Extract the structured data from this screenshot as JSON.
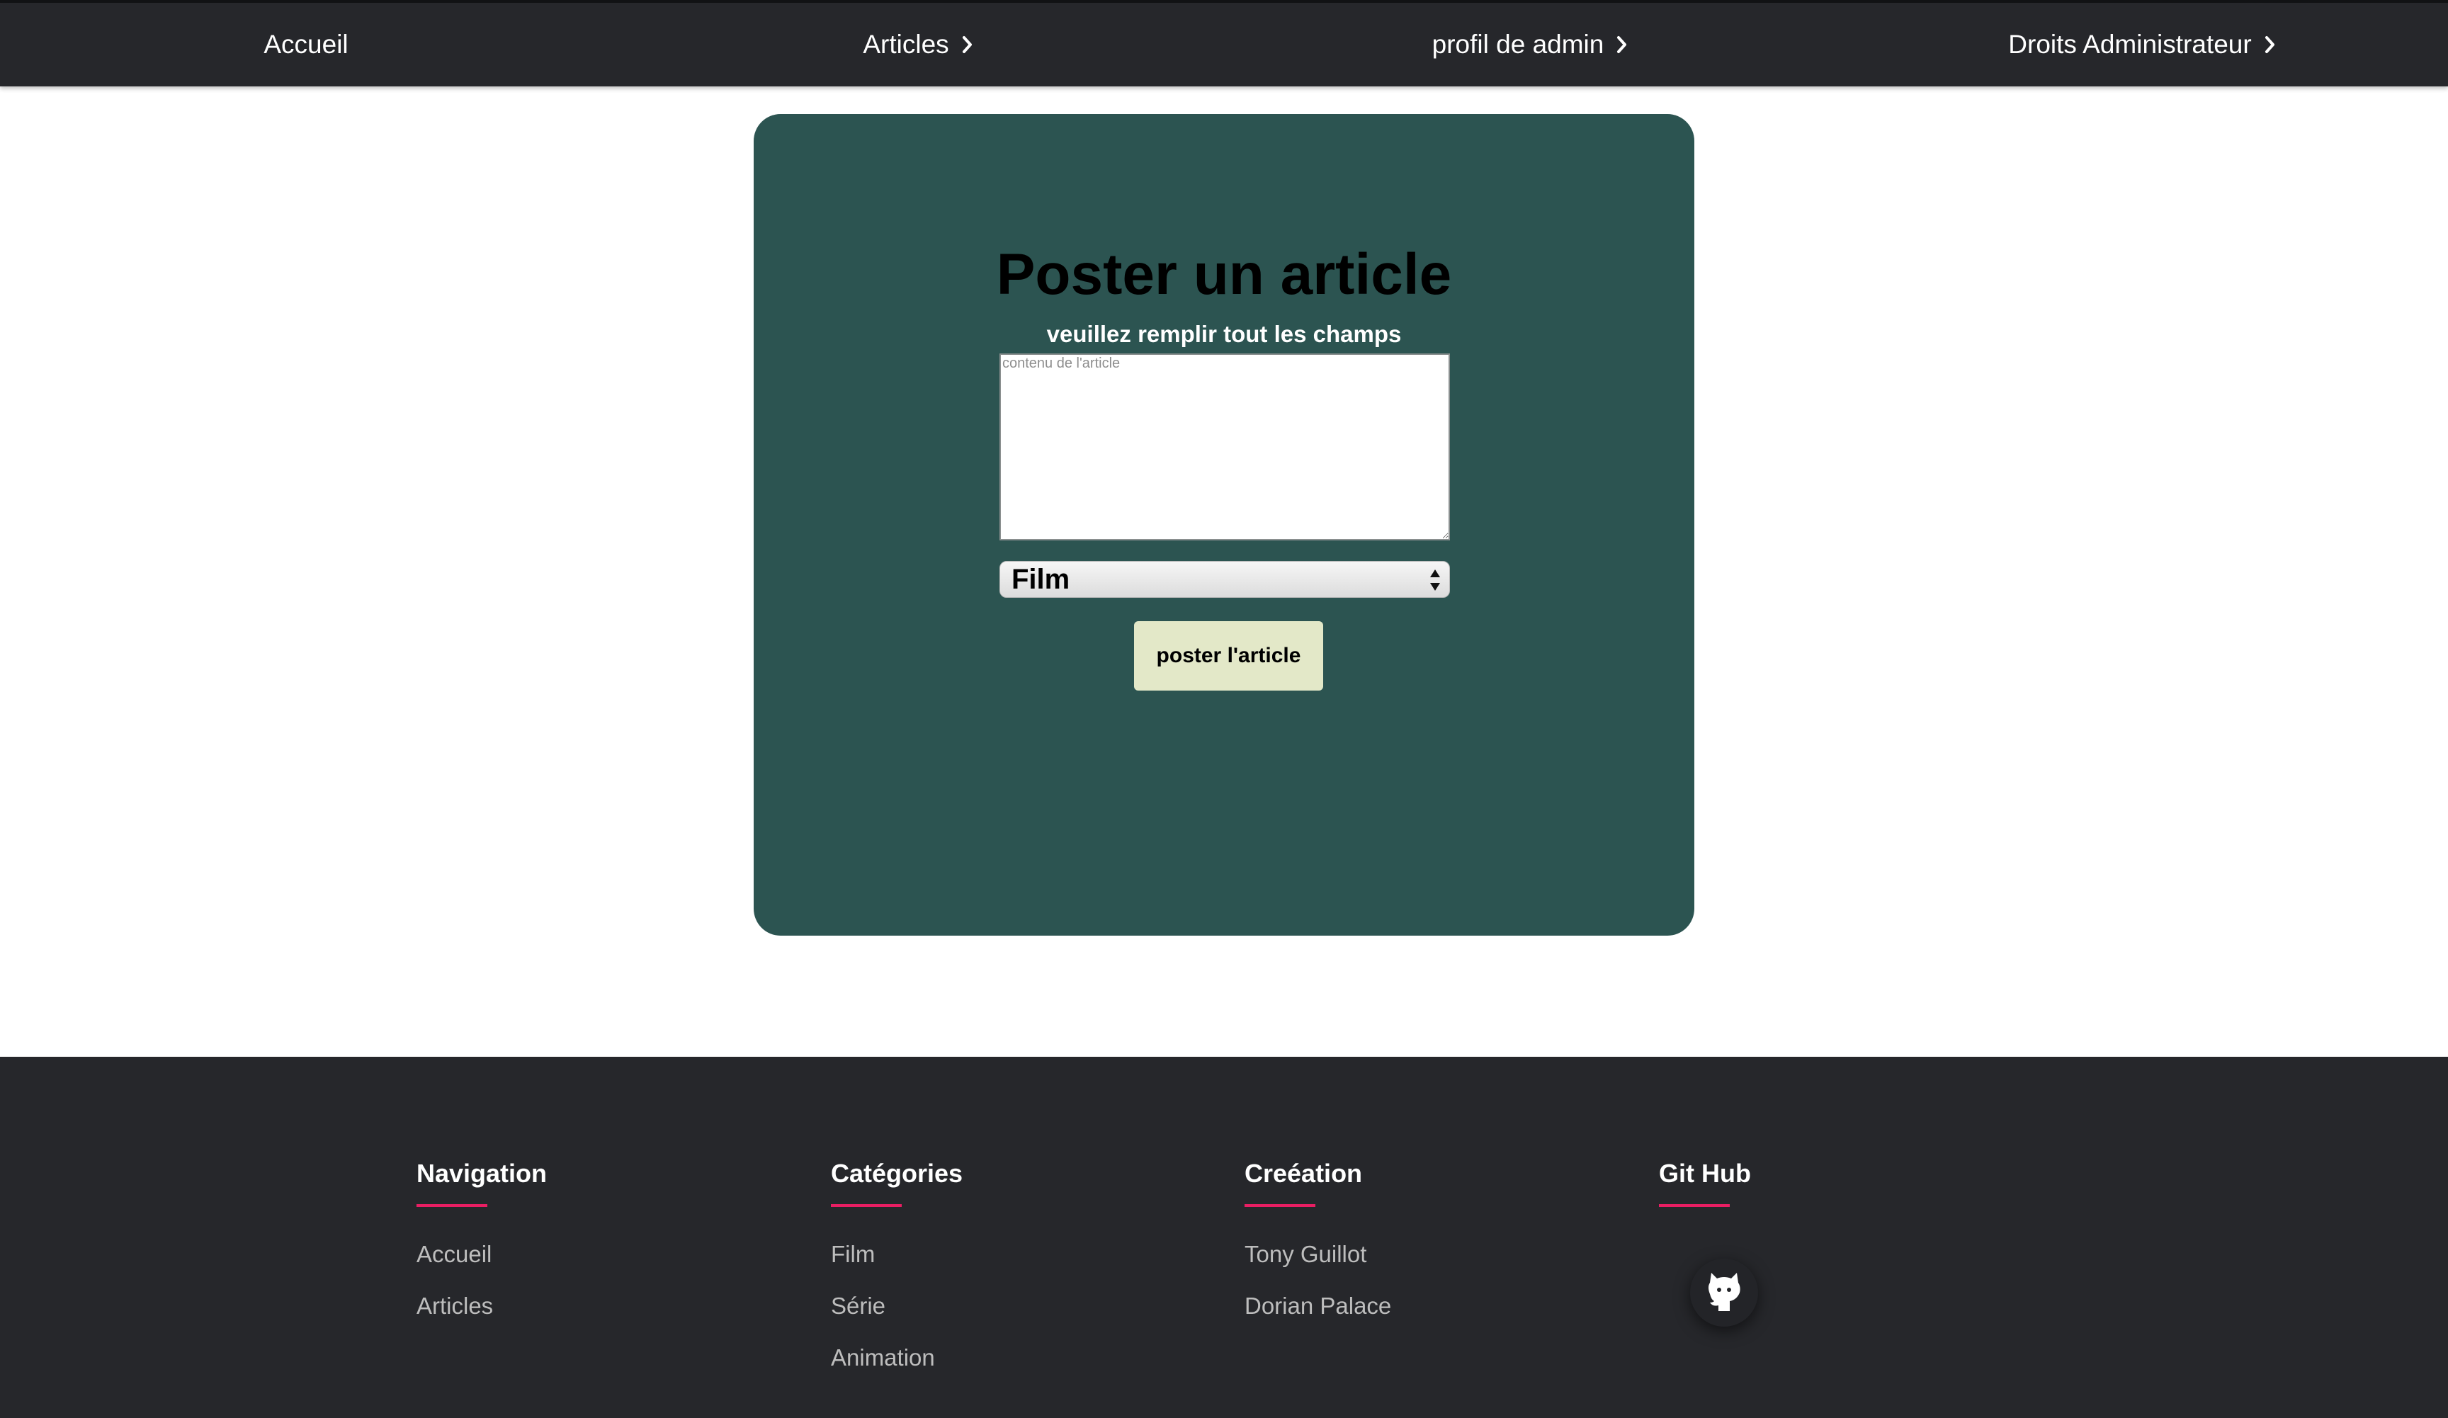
{
  "nav": {
    "items": [
      {
        "label": "Accueil",
        "has_chevron": false
      },
      {
        "label": "Articles",
        "has_chevron": true
      },
      {
        "label": "profil de admin",
        "has_chevron": true
      },
      {
        "label": "Droits Administrateur",
        "has_chevron": true
      }
    ]
  },
  "form": {
    "title": "Poster un article",
    "subtitle": "veuillez remplir tout les champs",
    "content_placeholder": "contenu de l'article",
    "content_value": "",
    "category_selected": "Film",
    "submit_label": "poster l'article"
  },
  "footer": {
    "columns": [
      {
        "heading": "Navigation",
        "links": [
          "Accueil",
          "Articles"
        ]
      },
      {
        "heading": "Catégories",
        "links": [
          "Film",
          "Série",
          "Animation"
        ]
      },
      {
        "heading": "Creéation",
        "links": [
          "Tony Guillot",
          "Dorian Palace"
        ]
      },
      {
        "heading": "Git Hub",
        "links": []
      }
    ],
    "github_icon": "github-icon"
  },
  "colors": {
    "nav_bg": "#26272b",
    "card_bg": "#2c5451",
    "button_bg": "#e3e8c8",
    "footer_bg": "#26272b",
    "accent_underline": "#e91e63"
  }
}
